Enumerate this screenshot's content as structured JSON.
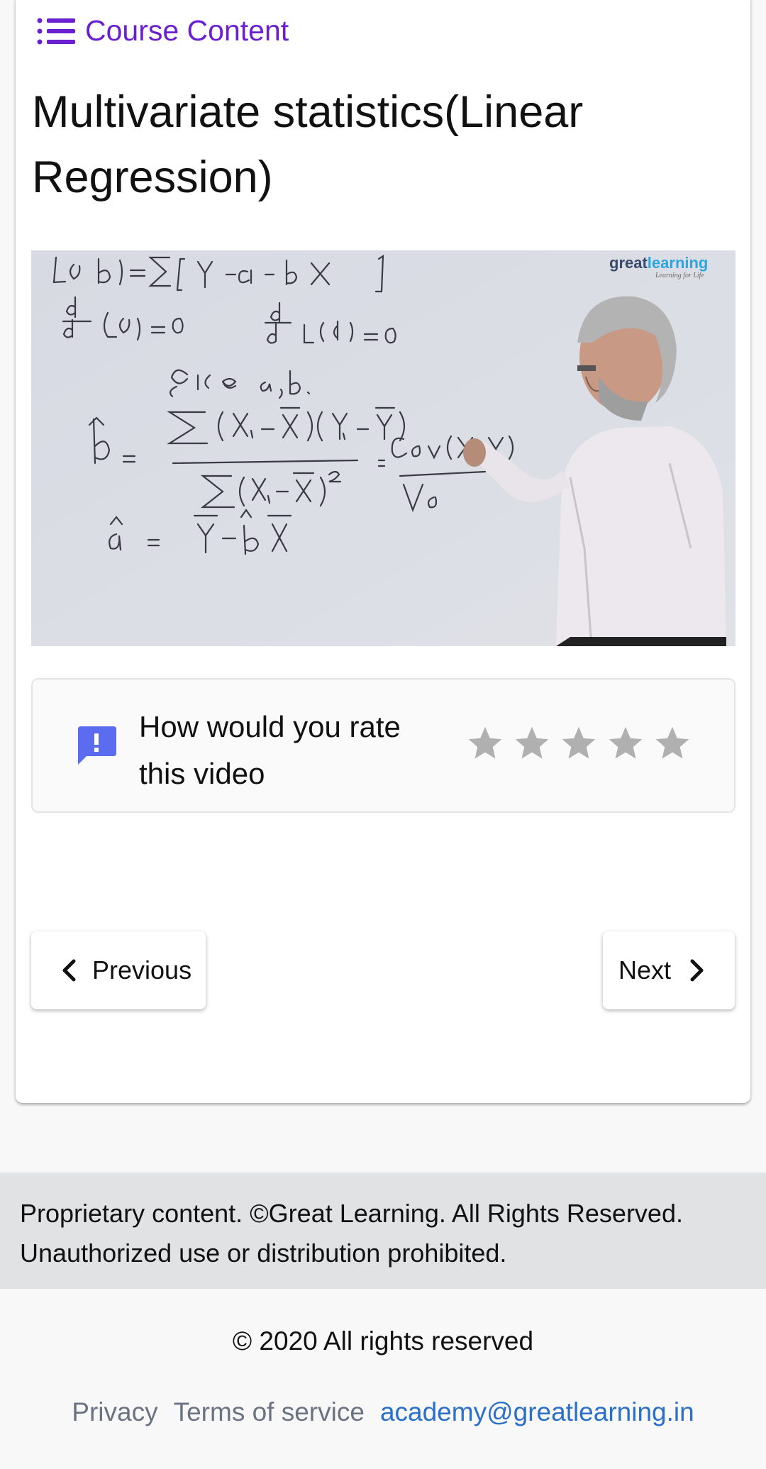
{
  "header": {
    "course_content_label": "Course Content",
    "course_content_icon": "list-icon",
    "accent_color": "#6a1fd1"
  },
  "lesson": {
    "title": "Multivariate statistics(Linear Regression)"
  },
  "video": {
    "brand_logo_text": "greatlearning",
    "brand_tagline": "Learning for Life"
  },
  "rating": {
    "icon": "feedback-icon",
    "icon_color": "#5b6cf0",
    "question": "How would you rate this video",
    "stars_total": 5,
    "stars_selected": 0,
    "star_color": "#b0b0b0"
  },
  "navigation": {
    "previous_label": "Previous",
    "next_label": "Next"
  },
  "footer": {
    "proprietary_notice": "Proprietary content. ©Great Learning. All Rights Reserved. Unauthorized use or distribution prohibited.",
    "copyright": "© 2020 All rights reserved",
    "privacy_label": "Privacy",
    "terms_label": "Terms of service",
    "email_label": "academy@greatlearning.in"
  }
}
